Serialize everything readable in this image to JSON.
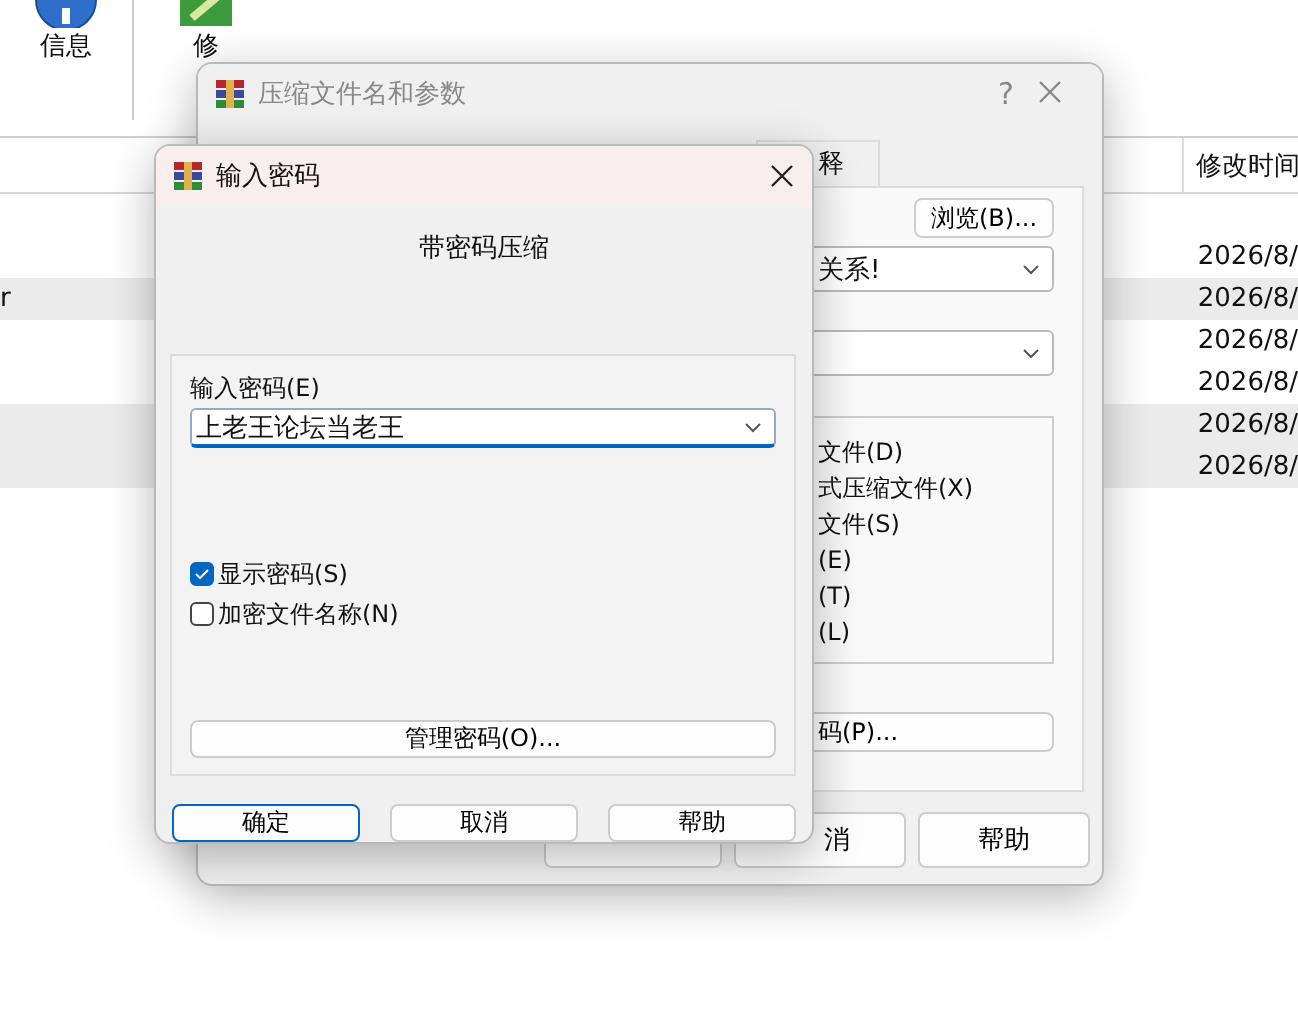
{
  "app": {
    "toolbar": [
      {
        "label": "信息",
        "kind": "info"
      },
      {
        "label": "修",
        "kind": "repair"
      }
    ],
    "list": {
      "columns": [
        "修改时间"
      ],
      "rows": [
        {
          "column_1": "",
          "date": "2026/8/",
          "selected": false
        },
        {
          "column_1": "r",
          "date": "2026/8/",
          "selected": true
        },
        {
          "column_1": "",
          "date": "2026/8/",
          "selected": false
        },
        {
          "column_1": "",
          "date": "2026/8/",
          "selected": false
        },
        {
          "column_1": "",
          "date": "2026/8/",
          "selected": true
        },
        {
          "column_1": "",
          "date": "2026/8/",
          "selected": true
        }
      ]
    }
  },
  "archive_dialog": {
    "title": "压缩文件名和参数",
    "help": "?",
    "tabs": [
      {
        "label": "释",
        "selected": false
      }
    ],
    "browse_button": "浏览(B)...",
    "archive_name": "关系!",
    "options": [
      "文件(D)",
      "式压缩文件(X)",
      "文件(S)",
      "(E)",
      "(T)",
      "(L)"
    ],
    "password_button": "码(P)...",
    "buttons": [
      "消",
      "帮助"
    ]
  },
  "password_dialog": {
    "title": "输入密码",
    "heading": "带密码压缩",
    "field_label": "输入密码(E)",
    "password": "上老王论坛当老王",
    "checkboxes": [
      {
        "label": "显示密码(S)",
        "checked": true
      },
      {
        "label": "加密文件名称(N)",
        "checked": false
      }
    ],
    "manage_button": "管理密码(O)...",
    "buttons": [
      {
        "label": "确定",
        "default": true
      },
      {
        "label": "取消",
        "default": false
      },
      {
        "label": "帮助",
        "default": false
      }
    ]
  }
}
